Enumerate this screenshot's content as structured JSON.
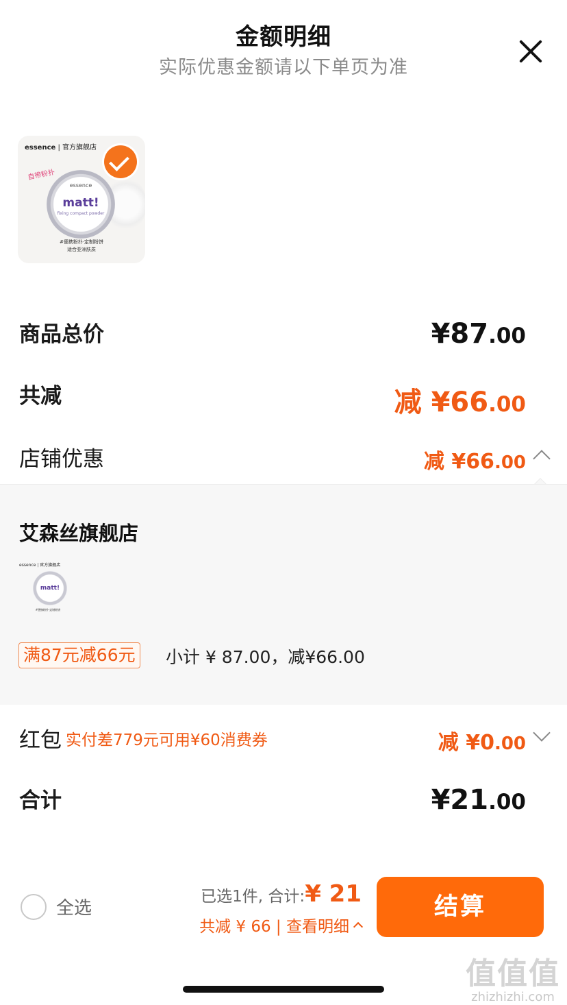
{
  "header": {
    "title": "金额明细",
    "subtitle": "实际优惠金额请以下单页为准"
  },
  "product": {
    "brand_label_prefix": "essence",
    "brand_label_suffix": "| 官方旗舰店",
    "tag": "自带粉扑",
    "compact_brand": "essence",
    "compact_line": "all about",
    "compact_name": "matt!",
    "compact_sub": "fixing compact powder",
    "caption_1": "#便携粉扑·定制粉饼",
    "caption_2": "适合亚洲肤质",
    "selected": true
  },
  "rows": {
    "total_label": "商品总价",
    "total_currency": "¥",
    "total_int": "87",
    "total_cents": ".00",
    "discount_label": "共减",
    "discount_prefix": "减",
    "discount_currency": "¥",
    "discount_int": "66",
    "discount_cents": ".00",
    "store_label": "店铺优惠",
    "store_prefix": "减",
    "store_currency": "¥",
    "store_int": "66",
    "store_cents": ".00"
  },
  "shop_panel": {
    "shop_name": "艾森丝旗舰店",
    "promo_tag": "满87元减66元",
    "subtotal": "小计 ¥ 87.00，减¥66.00"
  },
  "red_packet": {
    "label": "红包",
    "note": "实付差779元可用¥60消费券",
    "prefix": "减",
    "currency": "¥",
    "int": "0",
    "cents": ".00"
  },
  "sum": {
    "label": "合计",
    "currency": "¥",
    "int": "21",
    "cents": ".00"
  },
  "footer": {
    "select_all": "全选",
    "selected_count": "已选1件, 合计:",
    "amount": "¥ 21",
    "discount_detail": "共减 ¥ 66 | 查看明细",
    "checkout": "结算"
  },
  "watermark": {
    "glyphs": "值值值",
    "url": "zhizhizhi.com"
  },
  "colors": {
    "accent": "#f05a14",
    "button": "#ff6a0a",
    "panel_bg": "#f7f7f7"
  }
}
